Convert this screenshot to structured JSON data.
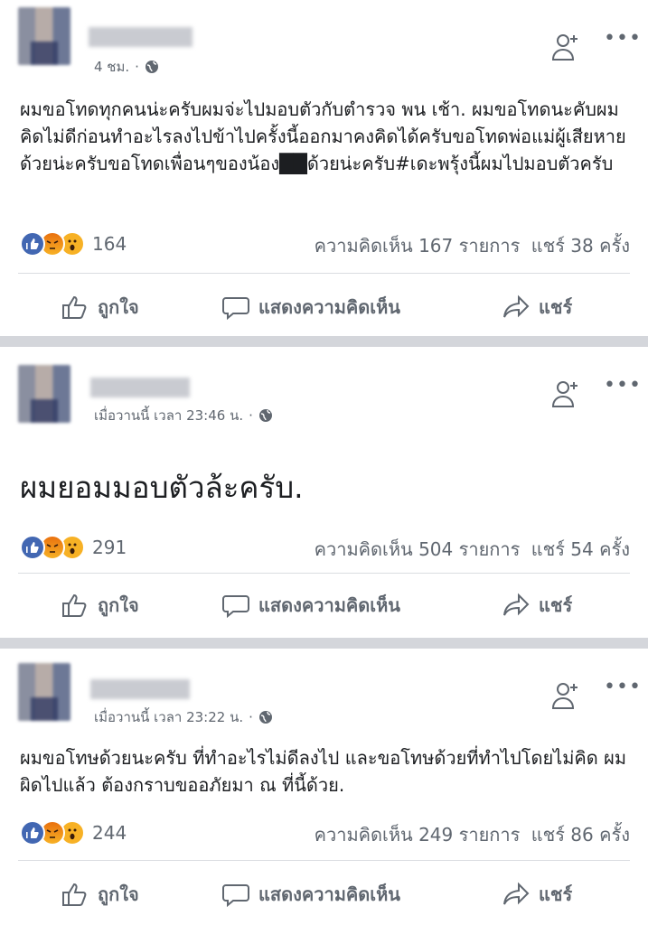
{
  "posts": [
    {
      "time": "4 ชม.",
      "text": "ผมขอโทดทุกคนน่ะครับผมจ่ะไปมอบตัวกับตำรวจ พน เช้า. ผมขอโทดนะคับผมคิดไม่ดีก่อนทำอะไรลงไปข้าไปครั้งนี้ออกมาคงคิดได้ครับขอโทดพ่อแม่ผู้เสียหายด้วยน่ะครับขอโทดเพื่อนๆของน้อง██ด้วยน่ะครับ#เดะพรุ้งนี้ผมไปมอบตัวครับ",
      "reaction_count": "164",
      "comments": "ความคิดเห็น 167 รายการ",
      "shares": "แชร์ 38 ครั้ง"
    },
    {
      "time": "เมื่อวานนี้ เวลา 23:46 น.",
      "text": "ผมยอมมอบตัวล้ะครับ.",
      "reaction_count": "291",
      "comments": "ความคิดเห็น 504 รายการ",
      "shares": "แชร์ 54 ครั้ง"
    },
    {
      "time": "เมื่อวานนี้ เวลา 23:22 น.",
      "text": "ผมขอโทษด้วยนะครับ ที่ทำอะไรไม่ดีลงไป และขอโทษด้วยที่ทำไปโดยไม่คิด ผมผิดไปแล้ว ต้องกราบขออภัยมา ณ ที่นี้ด้วย.",
      "reaction_count": "244",
      "comments": "ความคิดเห็น 249 รายการ",
      "shares": "แชร์ 86 ครั้ง"
    }
  ],
  "actions": {
    "like": "ถูกใจ",
    "comment": "แสดงความคิดเห็น",
    "share": "แชร์"
  },
  "colors": {
    "like_blue": "#4267b2",
    "divider": "#d4d6db",
    "meta_gray": "#606770"
  },
  "icons": [
    "globe-icon",
    "add-friend-icon",
    "more-icon",
    "like-icon",
    "comment-icon",
    "share-icon"
  ]
}
